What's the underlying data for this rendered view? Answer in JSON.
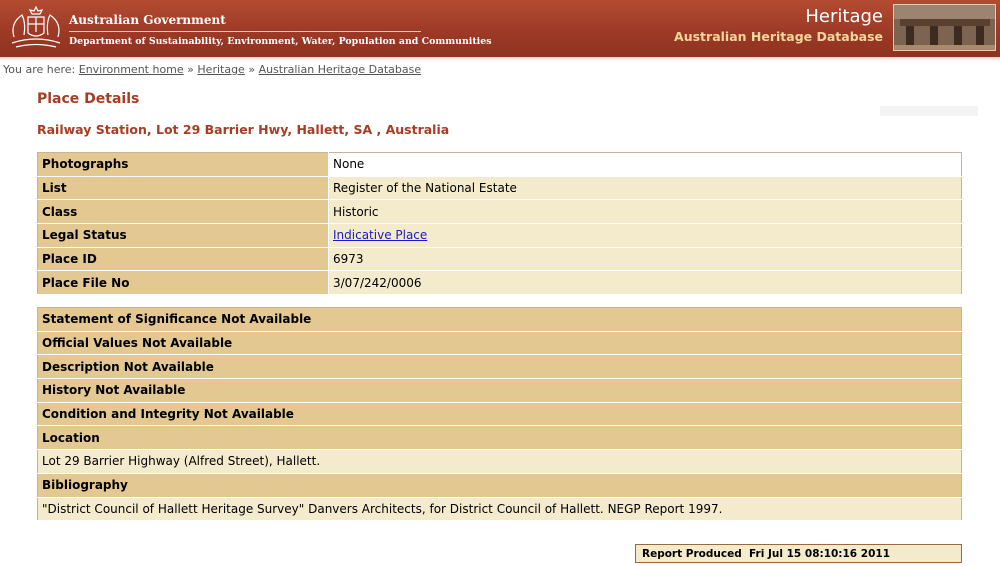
{
  "header": {
    "gov_title": "Australian Government",
    "department": "Department of Sustainability, Environment, Water, Population and Communities",
    "section_title": "Heritage",
    "database_title": "Australian Heritage Database"
  },
  "breadcrumb": {
    "prefix": "You are here:",
    "items": [
      "Environment home",
      "Heritage",
      "Australian Heritage Database"
    ],
    "separator": "»"
  },
  "page_title": "Place Details",
  "place_name": "Railway Station, Lot 29 Barrier Hwy, Hallett, SA , Australia",
  "details": [
    {
      "label": "Photographs",
      "value": "None"
    },
    {
      "label": "List",
      "value": "Register of the National Estate"
    },
    {
      "label": "Class",
      "value": "Historic"
    },
    {
      "label": "Legal Status",
      "value": "Indicative Place"
    },
    {
      "label": "Place ID",
      "value": "6973"
    },
    {
      "label": "Place File No",
      "value": "3/07/242/0006"
    }
  ],
  "sections": {
    "significance": "Statement of Significance Not Available",
    "official_values": "Official Values Not Available",
    "description": "Description Not Available",
    "history": "History Not Available",
    "condition": "Condition and Integrity Not Available",
    "location_heading": "Location",
    "location_text": "Lot 29 Barrier Highway (Alfred Street), Hallett.",
    "bibliography_heading": "Bibliography",
    "bibliography_text": "\"District Council of Hallett Heritage Survey\" Danvers Architects, for District Council of Hallett. NEGP Report 1997."
  },
  "footer": {
    "report_label": "Report Produced",
    "report_date": "Fri Jul 15 08:10:16 2011"
  },
  "colors": {
    "header_bg": "#9d3a26",
    "title_red": "#a63d24",
    "label_bg": "#e3c892",
    "value_bg": "#f4ebcc",
    "link": "#1a1acc"
  }
}
